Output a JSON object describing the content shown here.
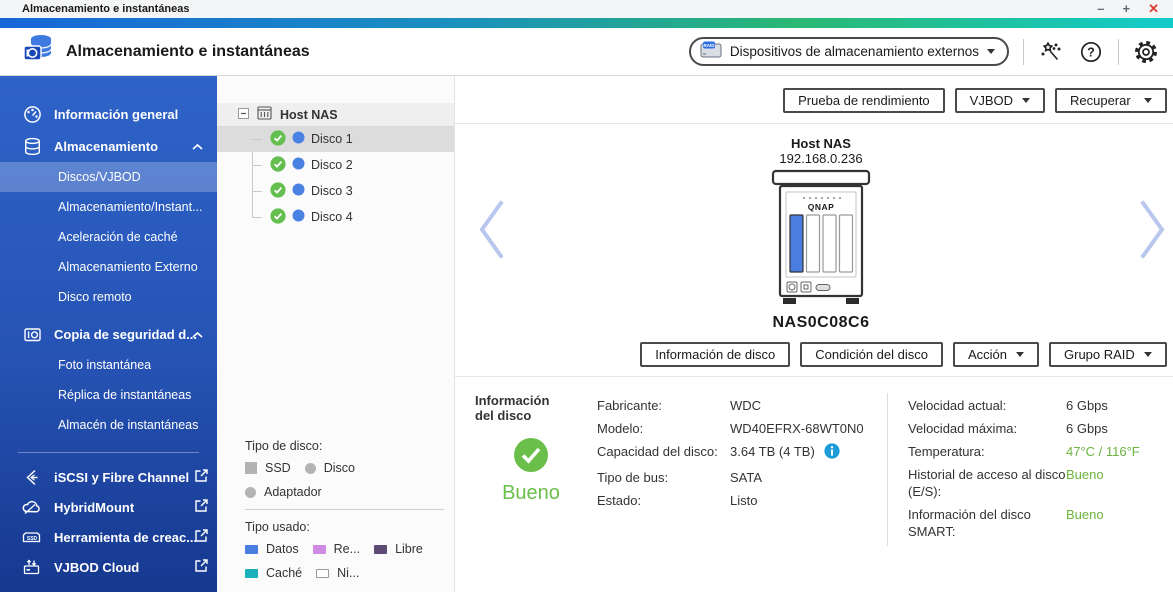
{
  "window": {
    "title": "Almacenamiento e instantáneas",
    "minimize": "–",
    "maximize": "+",
    "close": "✕"
  },
  "header": {
    "app_title": "Almacenamiento e instantáneas",
    "external_devices": "Dispositivos de almacenamiento externos"
  },
  "sidebar": {
    "items": [
      {
        "label": "Información general"
      },
      {
        "label": "Almacenamiento"
      },
      {
        "label": "Discos/VJBOD"
      },
      {
        "label": "Almacenamiento/Instant..."
      },
      {
        "label": "Aceleración de caché"
      },
      {
        "label": "Almacenamiento Externo"
      },
      {
        "label": "Disco remoto"
      },
      {
        "label": "Copia de seguridad d..."
      },
      {
        "label": "Foto instantánea"
      },
      {
        "label": "Réplica de instantáneas"
      },
      {
        "label": "Almacén de instantáneas"
      },
      {
        "label": "iSCSI y Fibre Channel"
      },
      {
        "label": "HybridMount"
      },
      {
        "label": "Herramienta de creac..."
      },
      {
        "label": "VJBOD Cloud"
      }
    ]
  },
  "tree": {
    "root": "Host NAS",
    "disks": [
      "Disco 1",
      "Disco 2",
      "Disco 3",
      "Disco 4"
    ],
    "selected": "Disco 1"
  },
  "legend": {
    "disk_type_title": "Tipo de disco:",
    "disk_types": [
      {
        "label": "SSD"
      },
      {
        "label": "Disco"
      },
      {
        "label": "Adaptador"
      }
    ],
    "used_type_title": "Tipo usado:",
    "used_types": [
      {
        "label": "Datos",
        "style": "background:#4a7de0"
      },
      {
        "label": "Re...",
        "style": "background:#cf8be4"
      },
      {
        "label": "Libre",
        "style": "background:#5d4a75"
      },
      {
        "label": "Caché",
        "style": "background:#1cb0b8"
      },
      {
        "label": "Ni...",
        "style": "background:#ffffff;border:1px solid #9a9a9a"
      }
    ]
  },
  "toolbar": {
    "performance_test": "Prueba de rendimiento",
    "vjbod": "VJBOD",
    "recover": "Recuperar",
    "disk_information": "Información de disco",
    "disk_health": "Condición del disco",
    "action": "Acción",
    "raid_group": "Grupo RAID"
  },
  "nas": {
    "host_label": "Host NAS",
    "ip": "192.168.0.236",
    "brand": "QNAP",
    "name": "NAS0C08C6"
  },
  "disk_info": {
    "section_title": "Información del disco",
    "status": "Bueno",
    "fields_left": [
      {
        "label": "Fabricante:",
        "value": "WDC"
      },
      {
        "label": "Modelo:",
        "value": "WD40EFRX-68WT0N0"
      },
      {
        "label": "Capacidad del disco:",
        "value": "3.64 TB (4 TB)"
      },
      {
        "label": "Tipo de bus:",
        "value": "SATA"
      },
      {
        "label": "Estado:",
        "value": "Listo"
      }
    ],
    "fields_right": [
      {
        "label": "Velocidad actual:",
        "value": "6 Gbps"
      },
      {
        "label": "Velocidad máxima:",
        "value": "6 Gbps"
      },
      {
        "label": "Temperatura:",
        "value": "47°C / 116°F"
      },
      {
        "label": "Historial de acceso al disco (E/S):",
        "value": "Bueno"
      },
      {
        "label": "Información del disco SMART:",
        "value": "Bueno"
      }
    ]
  },
  "colors": {
    "sidebar_top": "#2e63c8",
    "sidebar_bottom": "#16388f",
    "status_good_green": "#6abf4b",
    "value_green": "#6cb33f",
    "data_blue": "#4a7de0",
    "info_blue": "#1e9cd7",
    "close_red": "#e03c31",
    "gradient_bar": [
      "#1766d9",
      "#2ab873",
      "#13cbcb"
    ]
  }
}
